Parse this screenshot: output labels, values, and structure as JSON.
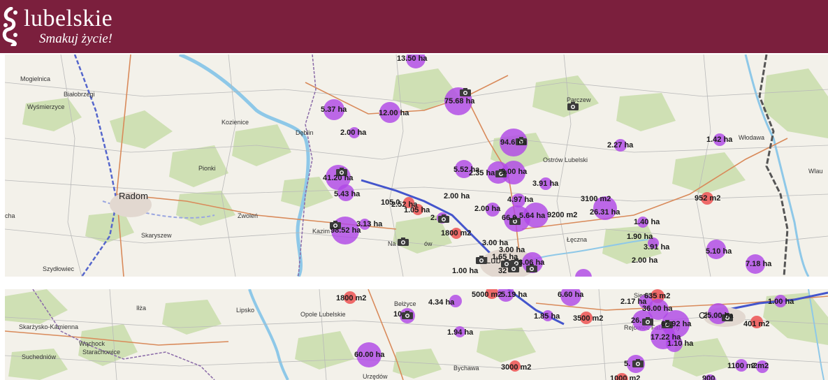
{
  "header": {
    "brand": "lubelskie",
    "tagline": "Smakuj życie!",
    "colors": {
      "background": "#7b1f3d",
      "text": "#ffffff"
    }
  },
  "map": {
    "marker_colors": {
      "ha": "#b048e6",
      "m2": "#ec5252"
    },
    "icon": "camera-icon",
    "top": {
      "places": [
        "Mogielnica",
        "Białobrzegi",
        "Wyśmierzyce",
        "Kozienice",
        "Dęblin",
        "Pionki",
        "Radom",
        "Zwoleń",
        "Skaryszew",
        "Szydłowiec",
        "Kazim",
        "Na",
        "ów",
        "Parczew",
        "Ostrów Lubelski",
        "Włodawa",
        "Łęczna",
        "Lub",
        "Wlau",
        "cha"
      ],
      "markers": [
        "13.50 ha",
        "75.68 ha",
        "5.37 ha",
        "12.00 ha",
        "2.00 ha",
        "94.6 ha",
        "2.27 ha",
        "1.42 ha",
        "5.52 ha",
        "2.35 ha",
        "3.00 ha",
        "41.20 ha",
        "5.43 ha",
        "3.91 ha",
        "2.00 ha",
        "4.97 ha",
        "105.0",
        "2.52 ha",
        "1.05 ha",
        "3100 m2",
        "2.00 ha",
        "66.0",
        "5.64 ha",
        "9200 m2",
        "26.31 ha",
        "952 m2",
        "3.13 ha",
        "98.52 ha",
        "2.",
        "1800 m2",
        "1.40 ha",
        "1.90 ha",
        "3.91 ha",
        "3.00 ha",
        "3.00 ha",
        "1.65 ha",
        "5.10 ha",
        "2.00 ha",
        "7.18 ha",
        "1.00 ha",
        "3.06 ha",
        "32"
      ]
    },
    "bottom": {
      "places": [
        "Skarżysko-Kamienna",
        "Wąchock",
        "Starachowice",
        "Suchedniów",
        "Iłża",
        "Lipsko",
        "Opole Lubelskie",
        "Bełżyce",
        "Bychawa",
        "Urzędów",
        "Siedliszcze",
        "Rejowiec Fabryczny",
        "Chełm"
      ],
      "markers": [
        "1800 m2",
        "10.",
        "4.34 ha",
        "5000 m2",
        "5.19 ha",
        "6.60 ha",
        "635 m2",
        "2.17 ha",
        "36.00 ha",
        "25.00 ha",
        "1.00 ha",
        "1.85 ha",
        "3500 m2",
        "26.",
        "63.92 ha",
        "401 m2",
        "1.94 ha",
        "17.22 ha",
        "1.10 ha",
        "60.00 ha",
        "3000 m2",
        "5.",
        "1100 m2",
        "2 m2",
        "1000 m2",
        "900"
      ]
    }
  }
}
